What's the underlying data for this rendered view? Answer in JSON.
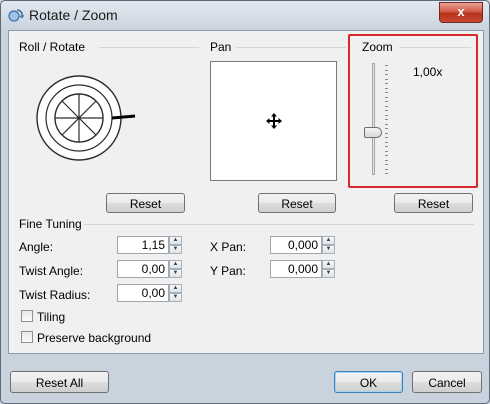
{
  "window": {
    "title": "Rotate / Zoom",
    "close_glyph": "x"
  },
  "roll": {
    "header": "Roll / Rotate",
    "reset_label": "Reset"
  },
  "pan": {
    "header": "Pan",
    "reset_label": "Reset",
    "cursor_icon": "move-cross-icon"
  },
  "zoom": {
    "header": "Zoom",
    "value_text": "1,00x",
    "reset_label": "Reset",
    "slider_position": 0.62
  },
  "fine_tuning": {
    "header": "Fine Tuning",
    "angle": {
      "label": "Angle:",
      "value": "1,15"
    },
    "twist_angle": {
      "label": "Twist Angle:",
      "value": "0,00"
    },
    "twist_radius": {
      "label": "Twist Radius:",
      "value": "0,00"
    },
    "x_pan": {
      "label": "X Pan:",
      "value": "0,000"
    },
    "y_pan": {
      "label": "Y Pan:",
      "value": "0,000"
    },
    "tiling": {
      "label": "Tiling",
      "checked": false
    },
    "preserve_background": {
      "label": "Preserve background",
      "checked": false
    }
  },
  "footer": {
    "reset_all_label": "Reset All",
    "ok_label": "OK",
    "cancel_label": "Cancel"
  },
  "colors": {
    "highlight": "#d9282b",
    "close_button": "#c9472f"
  }
}
